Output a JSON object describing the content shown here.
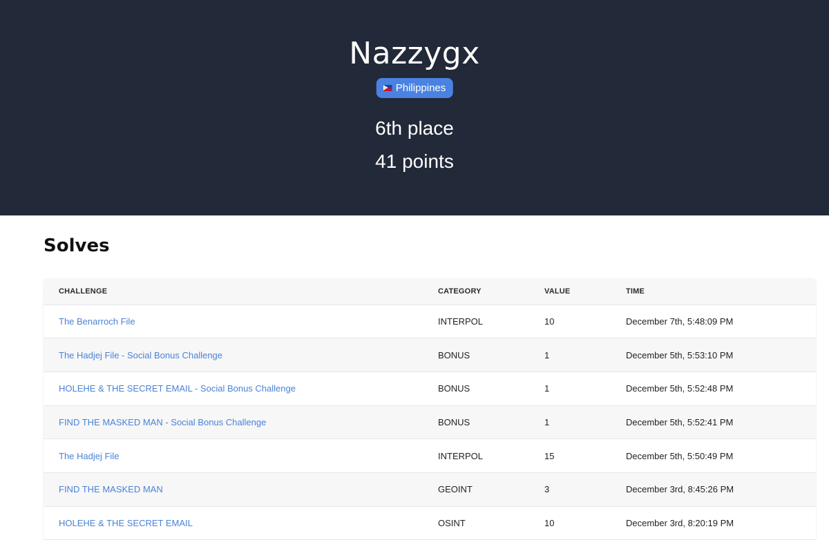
{
  "team": {
    "name": "Nazzygx",
    "country": "Philippines",
    "place": "6th place",
    "points": "41 points"
  },
  "solves": {
    "title": "Solves",
    "columns": [
      "CHALLENGE",
      "CATEGORY",
      "VALUE",
      "TIME"
    ],
    "rows": [
      {
        "challenge": "The Benarroch File",
        "category": "INTERPOL",
        "value": "10",
        "time": "December 7th, 5:48:09 PM"
      },
      {
        "challenge": "The Hadjej File - Social Bonus Challenge",
        "category": "BONUS",
        "value": "1",
        "time": "December 5th, 5:53:10 PM"
      },
      {
        "challenge": "HOLEHE & THE SECRET EMAIL - Social Bonus Challenge",
        "category": "BONUS",
        "value": "1",
        "time": "December 5th, 5:52:48 PM"
      },
      {
        "challenge": "FIND THE MASKED MAN - Social Bonus Challenge",
        "category": "BONUS",
        "value": "1",
        "time": "December 5th, 5:52:41 PM"
      },
      {
        "challenge": "The Hadjej File",
        "category": "INTERPOL",
        "value": "15",
        "time": "December 5th, 5:50:49 PM"
      },
      {
        "challenge": "FIND THE MASKED MAN",
        "category": "GEOINT",
        "value": "3",
        "time": "December 3rd, 8:45:26 PM"
      },
      {
        "challenge": "HOLEHE & THE SECRET EMAIL",
        "category": "OSINT",
        "value": "10",
        "time": "December 3rd, 8:20:19 PM"
      }
    ]
  },
  "colors": {
    "hero_bg": "#222938",
    "badge_bg": "#4a82e2",
    "link": "#4a82d6"
  },
  "icons": {
    "country_flag": "philippines-flag-icon"
  }
}
